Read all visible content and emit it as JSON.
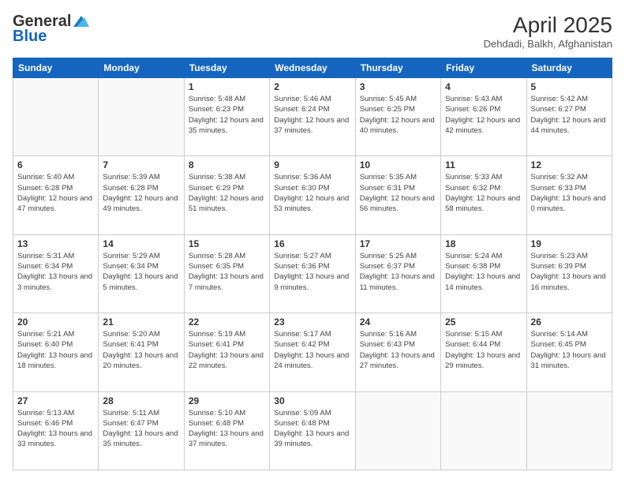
{
  "logo": {
    "general": "General",
    "blue": "Blue"
  },
  "header": {
    "title": "April 2025",
    "location": "Dehdadi, Balkh, Afghanistan"
  },
  "days_of_week": [
    "Sunday",
    "Monday",
    "Tuesday",
    "Wednesday",
    "Thursday",
    "Friday",
    "Saturday"
  ],
  "weeks": [
    [
      {
        "day": "",
        "info": ""
      },
      {
        "day": "",
        "info": ""
      },
      {
        "day": "1",
        "info": "Sunrise: 5:48 AM\nSunset: 6:23 PM\nDaylight: 12 hours and 35 minutes."
      },
      {
        "day": "2",
        "info": "Sunrise: 5:46 AM\nSunset: 6:24 PM\nDaylight: 12 hours and 37 minutes."
      },
      {
        "day": "3",
        "info": "Sunrise: 5:45 AM\nSunset: 6:25 PM\nDaylight: 12 hours and 40 minutes."
      },
      {
        "day": "4",
        "info": "Sunrise: 5:43 AM\nSunset: 6:26 PM\nDaylight: 12 hours and 42 minutes."
      },
      {
        "day": "5",
        "info": "Sunrise: 5:42 AM\nSunset: 6:27 PM\nDaylight: 12 hours and 44 minutes."
      }
    ],
    [
      {
        "day": "6",
        "info": "Sunrise: 5:40 AM\nSunset: 6:28 PM\nDaylight: 12 hours and 47 minutes."
      },
      {
        "day": "7",
        "info": "Sunrise: 5:39 AM\nSunset: 6:28 PM\nDaylight: 12 hours and 49 minutes."
      },
      {
        "day": "8",
        "info": "Sunrise: 5:38 AM\nSunset: 6:29 PM\nDaylight: 12 hours and 51 minutes."
      },
      {
        "day": "9",
        "info": "Sunrise: 5:36 AM\nSunset: 6:30 PM\nDaylight: 12 hours and 53 minutes."
      },
      {
        "day": "10",
        "info": "Sunrise: 5:35 AM\nSunset: 6:31 PM\nDaylight: 12 hours and 56 minutes."
      },
      {
        "day": "11",
        "info": "Sunrise: 5:33 AM\nSunset: 6:32 PM\nDaylight: 12 hours and 58 minutes."
      },
      {
        "day": "12",
        "info": "Sunrise: 5:32 AM\nSunset: 6:33 PM\nDaylight: 13 hours and 0 minutes."
      }
    ],
    [
      {
        "day": "13",
        "info": "Sunrise: 5:31 AM\nSunset: 6:34 PM\nDaylight: 13 hours and 3 minutes."
      },
      {
        "day": "14",
        "info": "Sunrise: 5:29 AM\nSunset: 6:34 PM\nDaylight: 13 hours and 5 minutes."
      },
      {
        "day": "15",
        "info": "Sunrise: 5:28 AM\nSunset: 6:35 PM\nDaylight: 13 hours and 7 minutes."
      },
      {
        "day": "16",
        "info": "Sunrise: 5:27 AM\nSunset: 6:36 PM\nDaylight: 13 hours and 9 minutes."
      },
      {
        "day": "17",
        "info": "Sunrise: 5:25 AM\nSunset: 6:37 PM\nDaylight: 13 hours and 11 minutes."
      },
      {
        "day": "18",
        "info": "Sunrise: 5:24 AM\nSunset: 6:38 PM\nDaylight: 13 hours and 14 minutes."
      },
      {
        "day": "19",
        "info": "Sunrise: 5:23 AM\nSunset: 6:39 PM\nDaylight: 13 hours and 16 minutes."
      }
    ],
    [
      {
        "day": "20",
        "info": "Sunrise: 5:21 AM\nSunset: 6:40 PM\nDaylight: 13 hours and 18 minutes."
      },
      {
        "day": "21",
        "info": "Sunrise: 5:20 AM\nSunset: 6:41 PM\nDaylight: 13 hours and 20 minutes."
      },
      {
        "day": "22",
        "info": "Sunrise: 5:19 AM\nSunset: 6:41 PM\nDaylight: 13 hours and 22 minutes."
      },
      {
        "day": "23",
        "info": "Sunrise: 5:17 AM\nSunset: 6:42 PM\nDaylight: 13 hours and 24 minutes."
      },
      {
        "day": "24",
        "info": "Sunrise: 5:16 AM\nSunset: 6:43 PM\nDaylight: 13 hours and 27 minutes."
      },
      {
        "day": "25",
        "info": "Sunrise: 5:15 AM\nSunset: 6:44 PM\nDaylight: 13 hours and 29 minutes."
      },
      {
        "day": "26",
        "info": "Sunrise: 5:14 AM\nSunset: 6:45 PM\nDaylight: 13 hours and 31 minutes."
      }
    ],
    [
      {
        "day": "27",
        "info": "Sunrise: 5:13 AM\nSunset: 6:46 PM\nDaylight: 13 hours and 33 minutes."
      },
      {
        "day": "28",
        "info": "Sunrise: 5:11 AM\nSunset: 6:47 PM\nDaylight: 13 hours and 35 minutes."
      },
      {
        "day": "29",
        "info": "Sunrise: 5:10 AM\nSunset: 6:48 PM\nDaylight: 13 hours and 37 minutes."
      },
      {
        "day": "30",
        "info": "Sunrise: 5:09 AM\nSunset: 6:48 PM\nDaylight: 13 hours and 39 minutes."
      },
      {
        "day": "",
        "info": ""
      },
      {
        "day": "",
        "info": ""
      },
      {
        "day": "",
        "info": ""
      }
    ]
  ]
}
